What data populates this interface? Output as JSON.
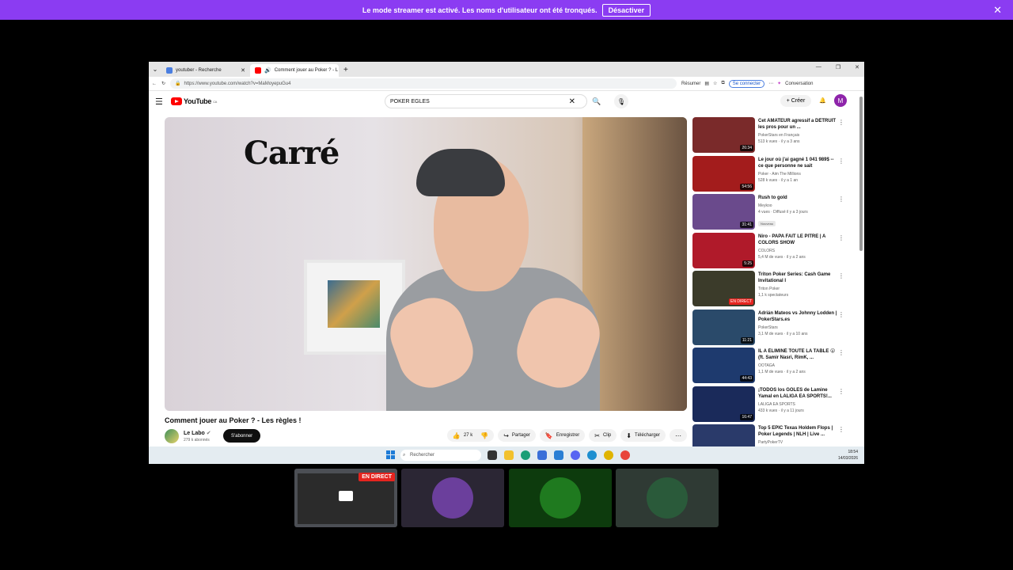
{
  "banner": {
    "message": "Le mode streamer est activé. Les noms d'utilisateur ont été tronqués.",
    "button": "Désactiver",
    "close": "✕"
  },
  "browser": {
    "tabs": [
      {
        "title": "youtuber - Recherche",
        "favicon_color": "#4a7ee0"
      },
      {
        "title": "Comment jouer au Poker ? - L",
        "favicon_color": "#ff0000"
      }
    ],
    "url": "https://www.youtube.com/watch?v=MaMoyepuGu4",
    "resume_label": "Résumer",
    "signin_label": "Se connecter",
    "conversation_label": "Conversation"
  },
  "youtube": {
    "logo": "YouTube",
    "region": "CA",
    "search_value": "POKER EGLES",
    "create_label": "Créer",
    "avatar_letter": "M",
    "video": {
      "overlay_text": "Carré",
      "title": "Comment jouer au Poker ? - Les règles !",
      "channel": "Le Labo",
      "subscribers": "279 k abonnés",
      "subscribe_label": "S'abonner",
      "likes": "27 k",
      "share_label": "Partager",
      "save_label": "Enregistrer",
      "clip_label": "Clip",
      "download_label": "Télécharger"
    },
    "recommendations": [
      {
        "title": "Cet AMATEUR agressif a DÉTRUIT les pros pour un ...",
        "channel": "PokerStars en Français",
        "stats": "513 k vues · il y a 3 ans",
        "duration": "26:34",
        "thumb_color": "#7a2a2a"
      },
      {
        "title": "Le jour où j'ai gagné 1 041 989$ -- ce que personne ne sait",
        "channel": "Poker - Aim The Millions",
        "stats": "528 k vues · il y a 1 an",
        "duration": "54:56",
        "thumb_color": "#a31c1c"
      },
      {
        "title": "Rush to gold",
        "channel": "Meykoo",
        "stats": "4 vues · Diffusé il y a 3 jours",
        "duration": "31:41",
        "thumb_color": "#6a4a8c",
        "badge": "Nouveau"
      },
      {
        "title": "Niro - PAPA FAIT LE PITRE | A COLORS SHOW",
        "channel": "COLORS",
        "stats": "5,4 M de vues · il y a 2 ans",
        "duration": "5:25",
        "thumb_color": "#b01a2a"
      },
      {
        "title": "Triton Poker Series: Cash Game Invitational I",
        "channel": "Triton Poker",
        "stats": "1,1 k spectateurs",
        "duration": "EN DIRECT",
        "thumb_color": "#3b3b2a"
      },
      {
        "title": "Adrián Mateos vs Johnny Lodden | PokerStars.es",
        "channel": "PokerStars",
        "stats": "3,1 M de vues · il y a 10 ans",
        "duration": "11:21",
        "thumb_color": "#2a4a6a"
      },
      {
        "title": "IL A ÉLIMINÉ TOUTE LA TABLE 😮 (ft. Samir Nasri, RimK, ...",
        "channel": "OOTAGA",
        "stats": "1,1 M de vues · il y a 2 ans",
        "duration": "44:43",
        "thumb_color": "#1e3a6e"
      },
      {
        "title": "¡TODOS los GOLES de Lamine Yamal en LALIGA EA SPORTS!...",
        "channel": "LALIGA EA SPORTS",
        "stats": "433 k vues · il y a 11 jours",
        "duration": "16:47",
        "thumb_color": "#1a2a5a"
      },
      {
        "title": "Top 5 EPIC Texas Holdem Flops | Poker Legends | NLH | Live ...",
        "channel": "PartyPokerTV",
        "stats": "",
        "duration": "",
        "thumb_color": "#2a3a6a"
      }
    ]
  },
  "taskbar": {
    "search_label": "Rechercher",
    "time": "18:54",
    "date": "14/03/2026"
  },
  "participants": {
    "live_badge": "EN DIRECT",
    "colors": [
      "#6b3f9c",
      "#1f7a1f",
      "#2a5a3a"
    ]
  }
}
